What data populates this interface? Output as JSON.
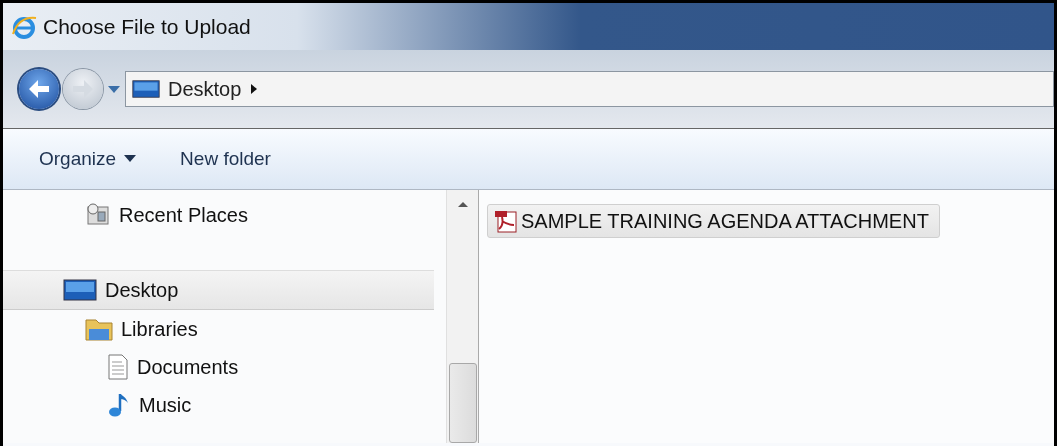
{
  "window": {
    "title": "Choose File to Upload"
  },
  "address_bar": {
    "crumbs": [
      "Desktop"
    ]
  },
  "toolbar": {
    "buttons": [
      {
        "label": "Organize",
        "kind": "menu"
      },
      {
        "label": "New folder",
        "kind": "plain"
      }
    ]
  },
  "sidebar": {
    "favorites": [
      {
        "label": "Recent Places",
        "kind": "recent",
        "selected": false
      }
    ],
    "tree": [
      {
        "label": "Desktop",
        "kind": "desktop",
        "selected": true,
        "children": [
          {
            "label": "Libraries",
            "kind": "library",
            "selected": false,
            "children": [
              {
                "label": "Documents",
                "kind": "documents",
                "selected": false
              },
              {
                "label": "Music",
                "kind": "music",
                "selected": false
              }
            ]
          }
        ]
      }
    ]
  },
  "files": [
    {
      "name": "SAMPLE TRAINING AGENDA ATTACHMENT",
      "kind": "pdf",
      "selected": true
    }
  ]
}
